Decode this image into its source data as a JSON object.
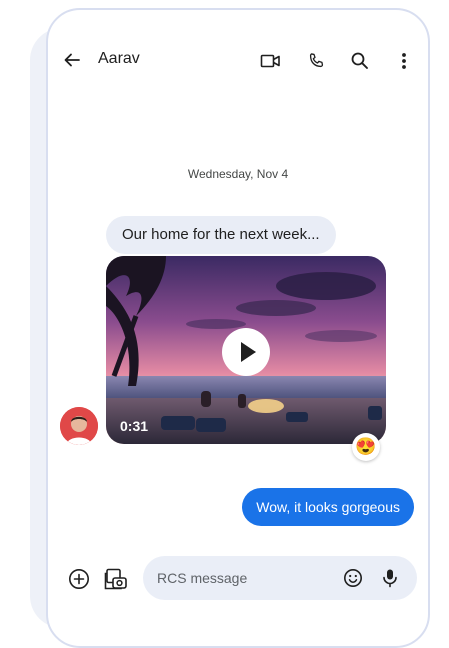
{
  "header": {
    "contact_name": "Aarav",
    "icons": [
      "back-arrow-icon",
      "video-call-icon",
      "phone-icon",
      "search-icon",
      "more-vert-icon"
    ]
  },
  "conversation": {
    "date_divider": "Wednesday, Nov 4",
    "messages": [
      {
        "direction": "incoming",
        "type": "text",
        "text": "Our home for the next week..."
      },
      {
        "direction": "incoming",
        "type": "video",
        "duration": "0:31",
        "reaction": "😍"
      },
      {
        "direction": "outgoing",
        "type": "text",
        "text": "Wow, it looks gorgeous"
      }
    ]
  },
  "composer": {
    "placeholder": "RCS message",
    "icons": [
      "add-icon",
      "gallery-icon",
      "emoji-icon",
      "mic-icon"
    ]
  },
  "colors": {
    "accent": "#1a73e8",
    "incoming_bubble": "#e9edf6",
    "composer_bg": "#eaeef7"
  }
}
